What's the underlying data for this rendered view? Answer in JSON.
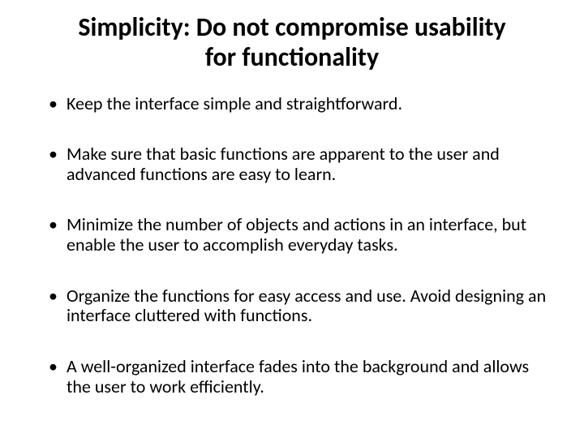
{
  "title": "Simplicity: Do not compromise usability for functionality",
  "bullets": [
    "Keep the interface simple and straightforward.",
    "Make sure that basic functions are apparent to the user and advanced functions are easy to learn.",
    "Minimize the number of objects and actions in an interface, but enable  the user to accomplish everyday tasks.",
    "Organize the functions for easy access and use. Avoid designing an interface cluttered with functions.",
    "A well-organized interface fades into the background and allows the user to work efficiently."
  ]
}
